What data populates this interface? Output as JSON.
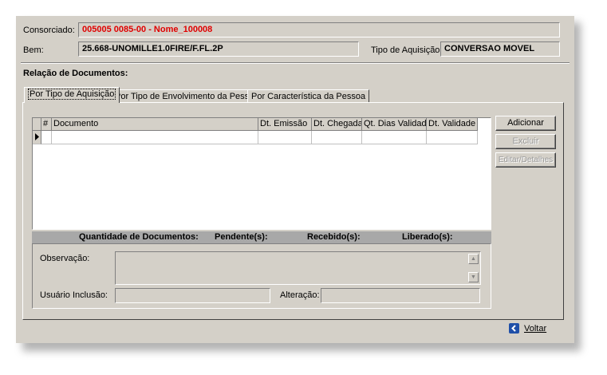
{
  "header": {
    "consorciado_label": "Consorciado:",
    "consorciado_value": "005005 0085-00 - Nome_100008",
    "bem_label": "Bem:",
    "bem_value": "25.668-UNOMILLE1.0FIRE/F.FL.2P",
    "tipo_aquisicao_label": "Tipo de Aquisição:",
    "tipo_aquisicao_value": "CONVERSAO MOVEL"
  },
  "section_title": "Relação de Documentos:",
  "tabs": [
    {
      "label": "Por Tipo de Aquisição",
      "active": true
    },
    {
      "label": "Por Tipo de Envolvimento da Pessoa",
      "active": false
    },
    {
      "label": "Por Característica da Pessoa",
      "active": false
    }
  ],
  "grid": {
    "columns": [
      "#",
      "Documento",
      "Dt. Emissão",
      "Dt. Chegada",
      "Qt. Dias Validade",
      "Dt. Validade"
    ]
  },
  "buttons": {
    "adicionar": "Adicionar",
    "excluir": "Excluir",
    "editar": "Editar/Detalhes",
    "voltar": "Voltar"
  },
  "summary": {
    "quantidade": "Quantidade de Documentos:",
    "pendentes": "Pendente(s):",
    "recebidos": "Recebido(s):",
    "liberados": "Liberado(s):"
  },
  "bottom": {
    "observacao_label": "Observação:",
    "usuario_label": "Usuário Inclusão:",
    "alteracao_label": "Alteração:"
  },
  "colors": {
    "window_bg": "#d4d0c8",
    "consorciado_text": "#e00000",
    "summary_bar": "#a8a8a8",
    "voltar_icon": "#1f4fa8"
  }
}
